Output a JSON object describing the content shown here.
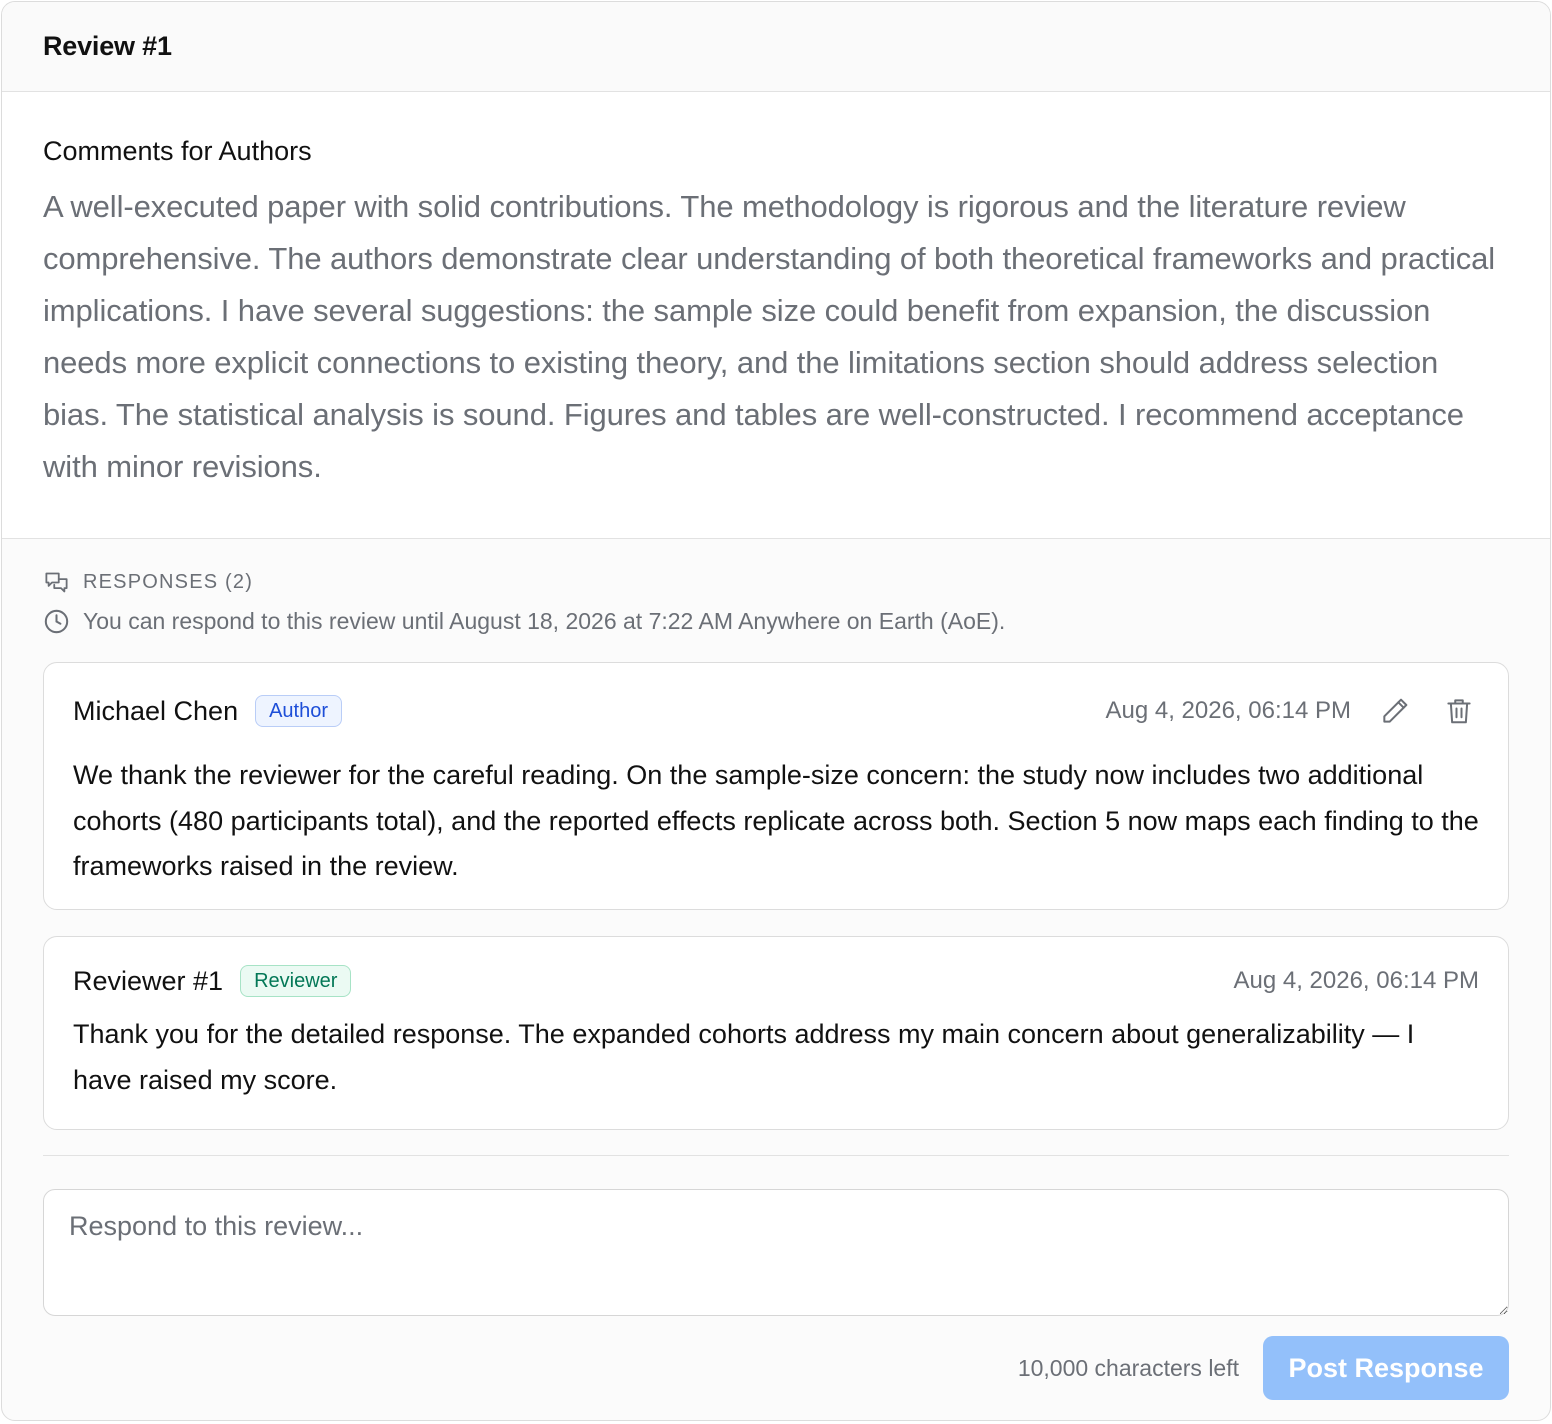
{
  "review": {
    "title": "Review #1",
    "comments_heading": "Comments for Authors",
    "comments_text": "A well-executed paper with solid contributions. The methodology is rigorous and the literature review comprehensive. The authors demonstrate clear understanding of both theoretical frameworks and practical implications. I have several suggestions: the sample size could benefit from expansion, the discussion needs more explicit connections to existing theory, and the limitations section should address selection bias. The statistical analysis is sound. Figures and tables are well-constructed. I recommend acceptance with minor revisions."
  },
  "responses": {
    "heading": "RESPONSES (2)",
    "deadline": "You can respond to this review until August 18, 2026 at 7:22 AM Anywhere on Earth (AoE).",
    "items": [
      {
        "author": "Michael Chen",
        "role": "Author",
        "date": "Aug 4, 2026, 06:14 PM",
        "text": "We thank the reviewer for the careful reading. On the sample-size concern: the study now includes two additional cohorts (480 participants total), and the reported effects replicate across both. Section 5 now maps each finding to the frameworks raised in the review."
      },
      {
        "author": "Reviewer #1",
        "role": "Reviewer",
        "date": "Aug 4, 2026, 06:14 PM",
        "text": "Thank you for the detailed response. The expanded cohorts address my main concern about generalizability — I have raised my score."
      }
    ]
  },
  "reply": {
    "placeholder": "Respond to this review...",
    "value": "",
    "chars_left": "10,000 characters left",
    "submit_label": "Post Response"
  },
  "colors": {
    "author_badge": "#1d4ed8",
    "reviewer_badge": "#047857",
    "post_button": "#93c0fa"
  },
  "icons": {
    "responses": "chat-bubbles-icon",
    "deadline": "clock-icon",
    "edit": "pencil-icon",
    "delete": "trash-icon"
  }
}
